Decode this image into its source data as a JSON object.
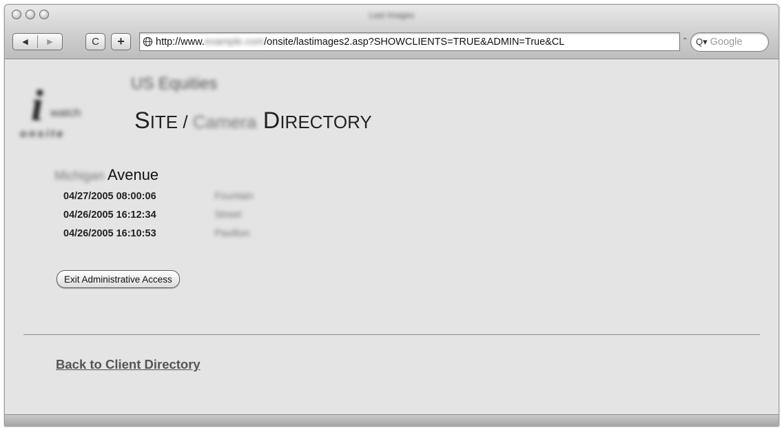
{
  "window": {
    "title": "Last Images"
  },
  "toolbar": {
    "back_glyph": "◀",
    "forward_glyph": "▶",
    "reload_glyph": "C",
    "add_glyph": "+",
    "url_prefix": "http://www.",
    "url_hidden": "example.com",
    "url_suffix": "/onsite/lastimages2.asp?SHOWCLIENTS=TRUE&ADMIN=True&CL",
    "url_expand_glyph": "⌃",
    "search_icon_glyph": "Q▾",
    "search_placeholder": "Google"
  },
  "page": {
    "company": "US Equities",
    "logo_letter": "i",
    "logo_word": "watch",
    "logo_row": "onsite",
    "title_prefix_first": "S",
    "title_prefix_rest": "ITE / ",
    "title_hidden": "Camera",
    "title_suffix_first": "D",
    "title_suffix_rest": "IRECTORY",
    "location_hidden": "Michigan",
    "location_label": "Avenue",
    "entries": [
      {
        "timestamp": "04/27/2005 08:00:06",
        "name": "Fountain"
      },
      {
        "timestamp": "04/26/2005 16:12:34",
        "name": "Street"
      },
      {
        "timestamp": "04/26/2005 16:10:53",
        "name": "Pavilion"
      }
    ],
    "exit_button": "Exit Administrative Access",
    "back_link": "Back to Client Directory"
  }
}
